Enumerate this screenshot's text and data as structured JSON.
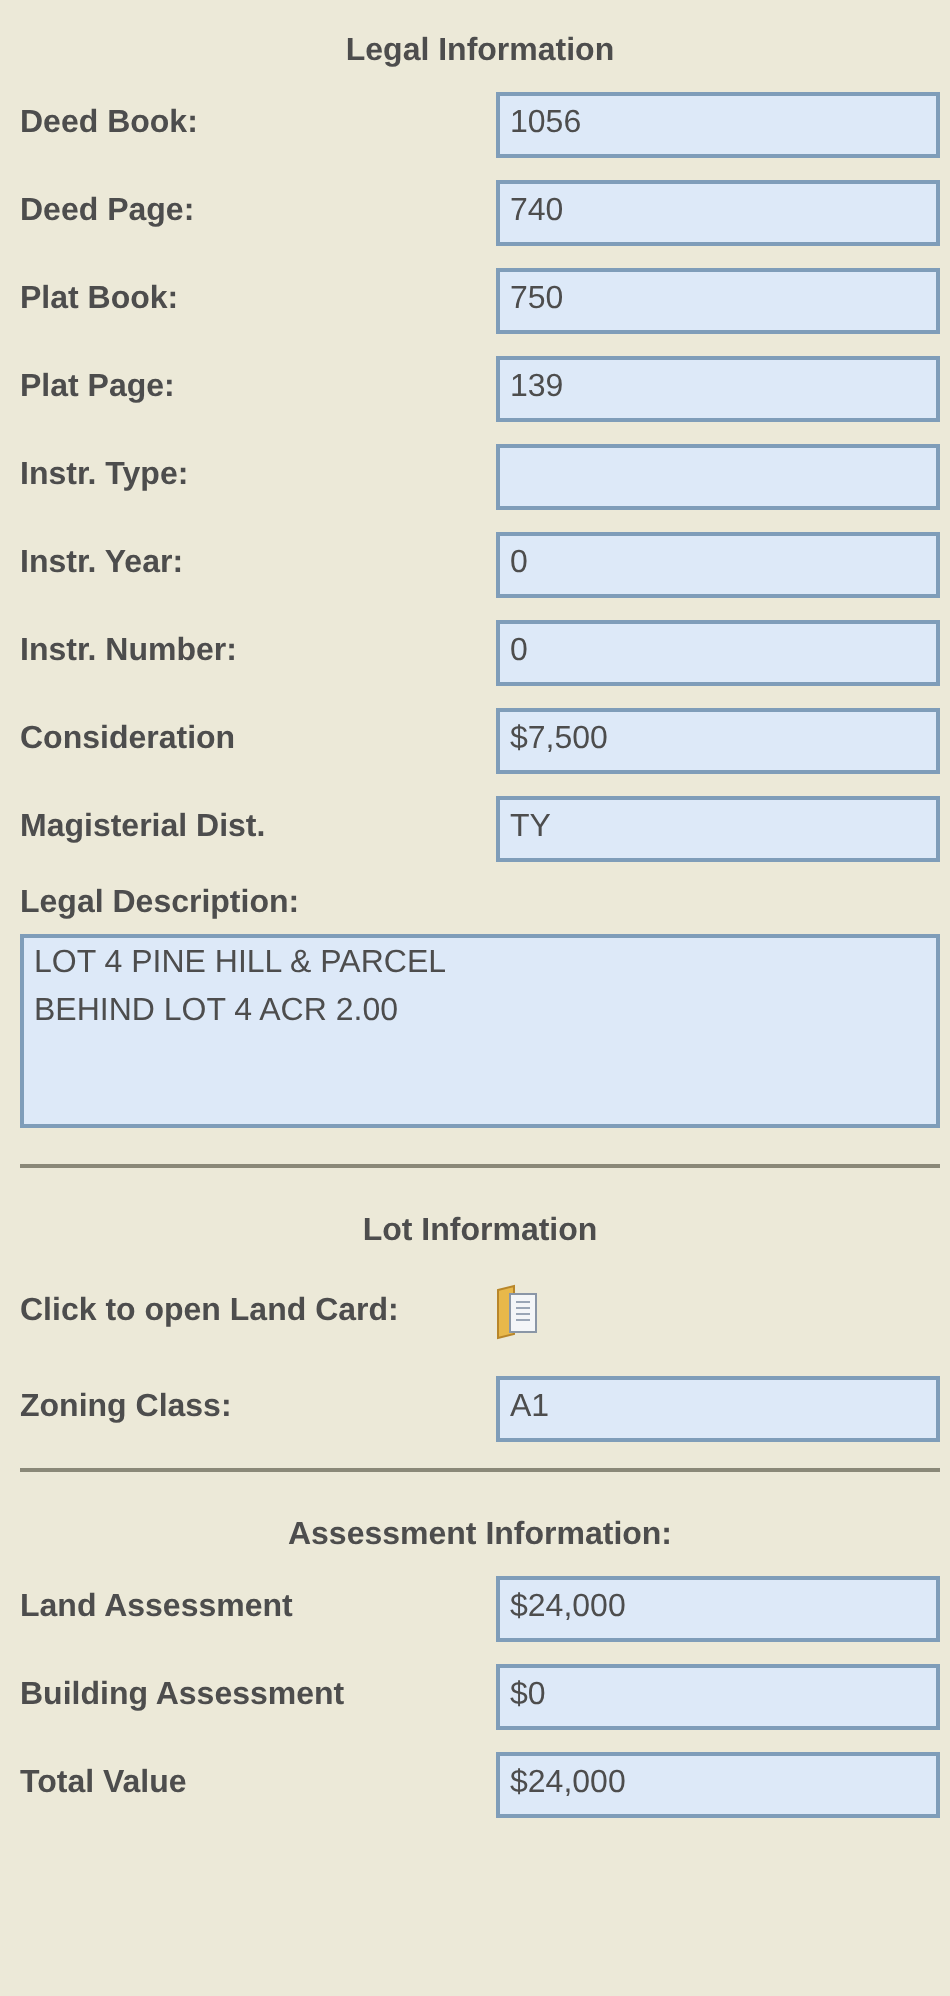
{
  "sections": [
    {
      "heading": "Legal Information",
      "rows": [
        {
          "kind": "field",
          "label": "Deed Book:",
          "value": "1056"
        },
        {
          "kind": "field",
          "label": "Deed Page:",
          "value": "740"
        },
        {
          "kind": "field",
          "label": "Plat Book:",
          "value": "750"
        },
        {
          "kind": "field",
          "label": "Plat Page:",
          "value": "139"
        },
        {
          "kind": "field",
          "label": "Instr. Type:"
        },
        {
          "kind": "field",
          "label": "Instr. Year:",
          "value": "0"
        },
        {
          "kind": "field",
          "label": "Instr. Number:",
          "value": "0"
        },
        {
          "kind": "field",
          "label": "Consideration",
          "value": "$7,500"
        },
        {
          "kind": "field",
          "label": "Magisterial Dist.",
          "value": "TY"
        },
        {
          "kind": "textarea",
          "label": "Legal Description:",
          "value": "LOT 4 PINE HILL & PARCEL\nBEHIND LOT 4 ACR 2.00"
        }
      ]
    },
    {
      "heading": "Lot Information",
      "rows": [
        {
          "kind": "link",
          "label": "Click to open Land Card:"
        },
        {
          "kind": "field",
          "label": "Zoning Class:",
          "value": "A1"
        }
      ]
    },
    {
      "heading": "Assessment Information:",
      "rows": [
        {
          "kind": "field",
          "label": "Land Assessment",
          "value": "$24,000"
        },
        {
          "kind": "field",
          "label": "Building Assessment",
          "value": "$0"
        },
        {
          "kind": "field",
          "label": "Total Value",
          "value": "$24,000"
        }
      ]
    }
  ]
}
